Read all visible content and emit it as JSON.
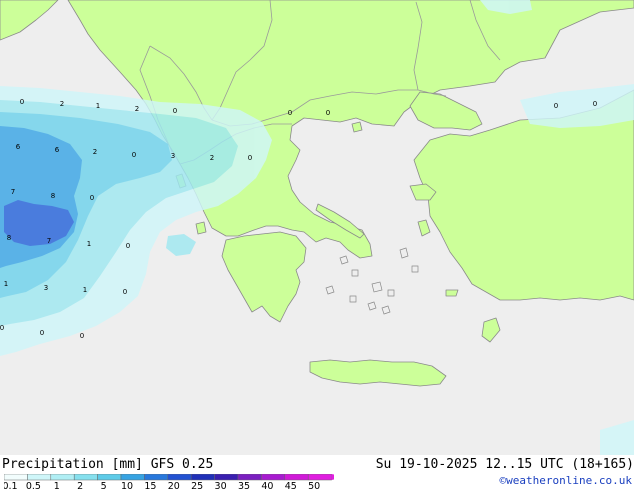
{
  "colors": {
    "sea": "#eeeeee",
    "land": "#ccff99",
    "coast": "#8a8a8a",
    "border": "#9a9a9a",
    "precip": [
      "#cff6f9",
      "#9fe8f1",
      "#6fd3ec",
      "#3aa6e6",
      "#2764da"
    ]
  },
  "title": "Precipitation [mm] GFS 0.25",
  "datetime": "Su 19-10-2025 12..15 UTC (18+165)",
  "credit": "©weatheronline.co.uk",
  "legend": {
    "labels": [
      "0.1",
      "0.5",
      "1",
      "2",
      "5",
      "10",
      "15",
      "20",
      "25",
      "30",
      "35",
      "40",
      "45",
      "50"
    ],
    "colors": [
      "#f2fdfd",
      "#cff6f9",
      "#b0eef4",
      "#86e0ee",
      "#5ecbe8",
      "#37a3e2",
      "#2878dc",
      "#2352d2",
      "#2030b8",
      "#3a1fb0",
      "#7b1fc0",
      "#a81bd0",
      "#d01ad8",
      "#e01ee0"
    ]
  },
  "grid_values": [
    {
      "text": "0",
      "name": "val-0a"
    },
    {
      "text": "2",
      "name": "val-2a"
    },
    {
      "text": "1",
      "name": "val-1a"
    },
    {
      "text": "2",
      "name": "val-2b"
    },
    {
      "text": "0",
      "name": "val-0b"
    },
    {
      "text": "0",
      "name": "val-0c"
    },
    {
      "text": "0",
      "name": "val-0d"
    },
    {
      "text": "0",
      "name": "val-0e"
    },
    {
      "text": "0",
      "name": "val-0f"
    },
    {
      "text": "6",
      "name": "val-6a"
    },
    {
      "text": "6",
      "name": "val-6b"
    },
    {
      "text": "2",
      "name": "val-2c"
    },
    {
      "text": "0",
      "name": "val-0g"
    },
    {
      "text": "3",
      "name": "val-3a"
    },
    {
      "text": "2",
      "name": "val-2d"
    },
    {
      "text": "0",
      "name": "val-0h"
    },
    {
      "text": "7",
      "name": "val-7a"
    },
    {
      "text": "8",
      "name": "val-8a"
    },
    {
      "text": "0",
      "name": "val-0i"
    },
    {
      "text": "8",
      "name": "val-8b"
    },
    {
      "text": "7",
      "name": "val-7b"
    },
    {
      "text": "1",
      "name": "val-1b"
    },
    {
      "text": "0",
      "name": "val-0j"
    },
    {
      "text": "1",
      "name": "val-1c"
    },
    {
      "text": "3",
      "name": "val-3b"
    },
    {
      "text": "1",
      "name": "val-1d"
    },
    {
      "text": "0",
      "name": "val-0k"
    },
    {
      "text": "0",
      "name": "val-0l"
    },
    {
      "text": "0",
      "name": "val-0m"
    },
    {
      "text": "0",
      "name": "val-0n"
    }
  ]
}
